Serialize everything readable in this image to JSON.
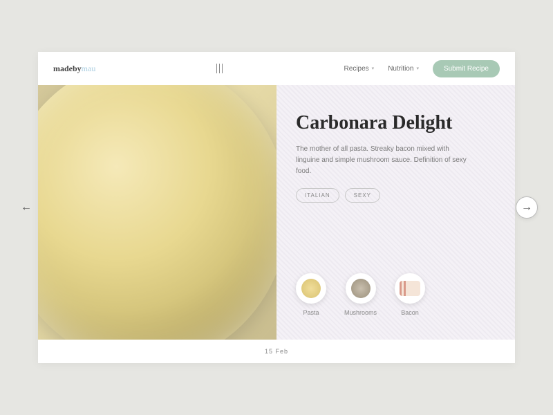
{
  "logo": {
    "main": "madeby",
    "sub": "mau"
  },
  "nav": {
    "items": [
      {
        "label": "Recipes"
      },
      {
        "label": "Nutrition"
      }
    ],
    "submit": "Submit Recipe"
  },
  "recipe": {
    "title": "Carbonara Delight",
    "description": "The mother of all pasta. Streaky bacon mixed with linguine and simple mushroom sauce. Definition of sexy food.",
    "tags": [
      "ITALIAN",
      "SEXY"
    ],
    "ingredients": [
      {
        "name": "Pasta"
      },
      {
        "name": "Mushrooms"
      },
      {
        "name": "Bacon"
      }
    ]
  },
  "date": "15 Feb",
  "colors": {
    "accent": "#a8c9b5",
    "logo_sub": "#a9cde0"
  }
}
